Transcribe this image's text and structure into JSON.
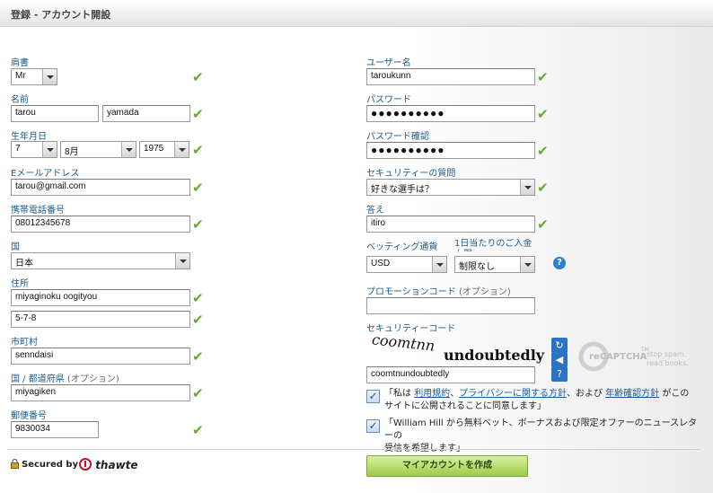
{
  "header": {
    "title": "登録 - アカウント開設"
  },
  "left": {
    "title_label": "肩書",
    "title_value": "Mr",
    "name_label": "名前",
    "first_name": "tarou",
    "last_name": "yamada",
    "dob_label": "生年月日",
    "dob_day": "7",
    "dob_month": "8月",
    "dob_year": "1975",
    "email_label": "Eメールアドレス",
    "email": "tarou@gmail.com",
    "mobile_label": "携帯電話番号",
    "mobile": "08012345678",
    "country_label": "国",
    "country": "日本",
    "address_label": "住所",
    "address1": "miyaginoku oogityou",
    "address2": "5-7-8",
    "city_label": "市町村",
    "city": "senndaisi",
    "state_label": "国 / 都道府県",
    "state_optional": "(オプション)",
    "state": "miyagiken",
    "postal_label": "郵便番号",
    "postal": "9830034"
  },
  "right": {
    "username_label": "ユーザー名",
    "username": "taroukunn",
    "password_label": "パスワード",
    "password": "●●●●●●●●●●",
    "password_confirm_label": "パスワード確認",
    "password_confirm": "●●●●●●●●●●",
    "security_q_label": "セキュリティーの質問",
    "security_q": "好きな選手は？",
    "answer_label": "答え",
    "answer": "itiro",
    "currency_label": "ベッティング通貨",
    "currency": "USD",
    "daily_limit_label": "1日当たりのご入金上限",
    "daily_limit": "制限なし",
    "promo_label": "プロモーションコード",
    "promo_optional": "(オプション)",
    "promo": "",
    "security_code_label": "セキュリティーコード",
    "captcha_word1": "coomtnn",
    "captcha_word2": "undoubtedly",
    "captcha_input": "coomtnundoubtedly",
    "recaptcha_brand": "reCAPTCHA",
    "recaptcha_tm": "TM",
    "recaptcha_tagline1": "stop spam.",
    "recaptcha_tagline2": "read books."
  },
  "consent": {
    "terms_prefix": "「私は",
    "terms_link": "利用規約",
    "terms_sep": "、",
    "privacy_link": "プライバシーに関する方針",
    "terms_and": "、および",
    "age_link": "年齢確認方針",
    "terms_suffix": "がこの",
    "terms_line2": "サイトに公開されることに同意します」",
    "marketing_line1": "「William Hill から無料ベット、ボーナスおよび限定オファーのニュースレターの",
    "marketing_line2": "受信を希望します」"
  },
  "footer": {
    "secured_by": "Secured by",
    "thawte": "thawte",
    "create_button": "マイアカウントを作成"
  },
  "icons": {
    "valid": "check-icon",
    "help": "help-icon",
    "refresh": "refresh-icon",
    "audio": "audio-icon",
    "info": "info-icon"
  },
  "colors": {
    "label": "#1a5a8a",
    "check": "#6aa82a",
    "button": "#9ccc4a"
  }
}
